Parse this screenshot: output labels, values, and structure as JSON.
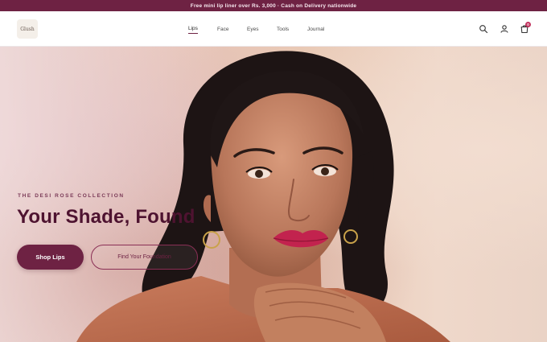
{
  "announcement": "Free mini lip liner over Rs. 3,000 · Cash on Delivery nationwide",
  "header": {
    "logo_text": "Glush",
    "nav": [
      "Lips",
      "Face",
      "Eyes",
      "Tools",
      "Journal"
    ],
    "active_nav": "Lips",
    "cart_count": "0"
  },
  "hero": {
    "eyebrow": "THE DESI ROSE COLLECTION",
    "headline": "Your Shade, Found",
    "primary_cta": "Shop Lips",
    "secondary_cta": "Find Your Foundation"
  },
  "colors": {
    "brand": "#6e2243",
    "announcement_bg": "#6e2243",
    "headline": "#4e1330"
  },
  "icons": [
    "search-icon",
    "account-icon",
    "cart-icon"
  ]
}
